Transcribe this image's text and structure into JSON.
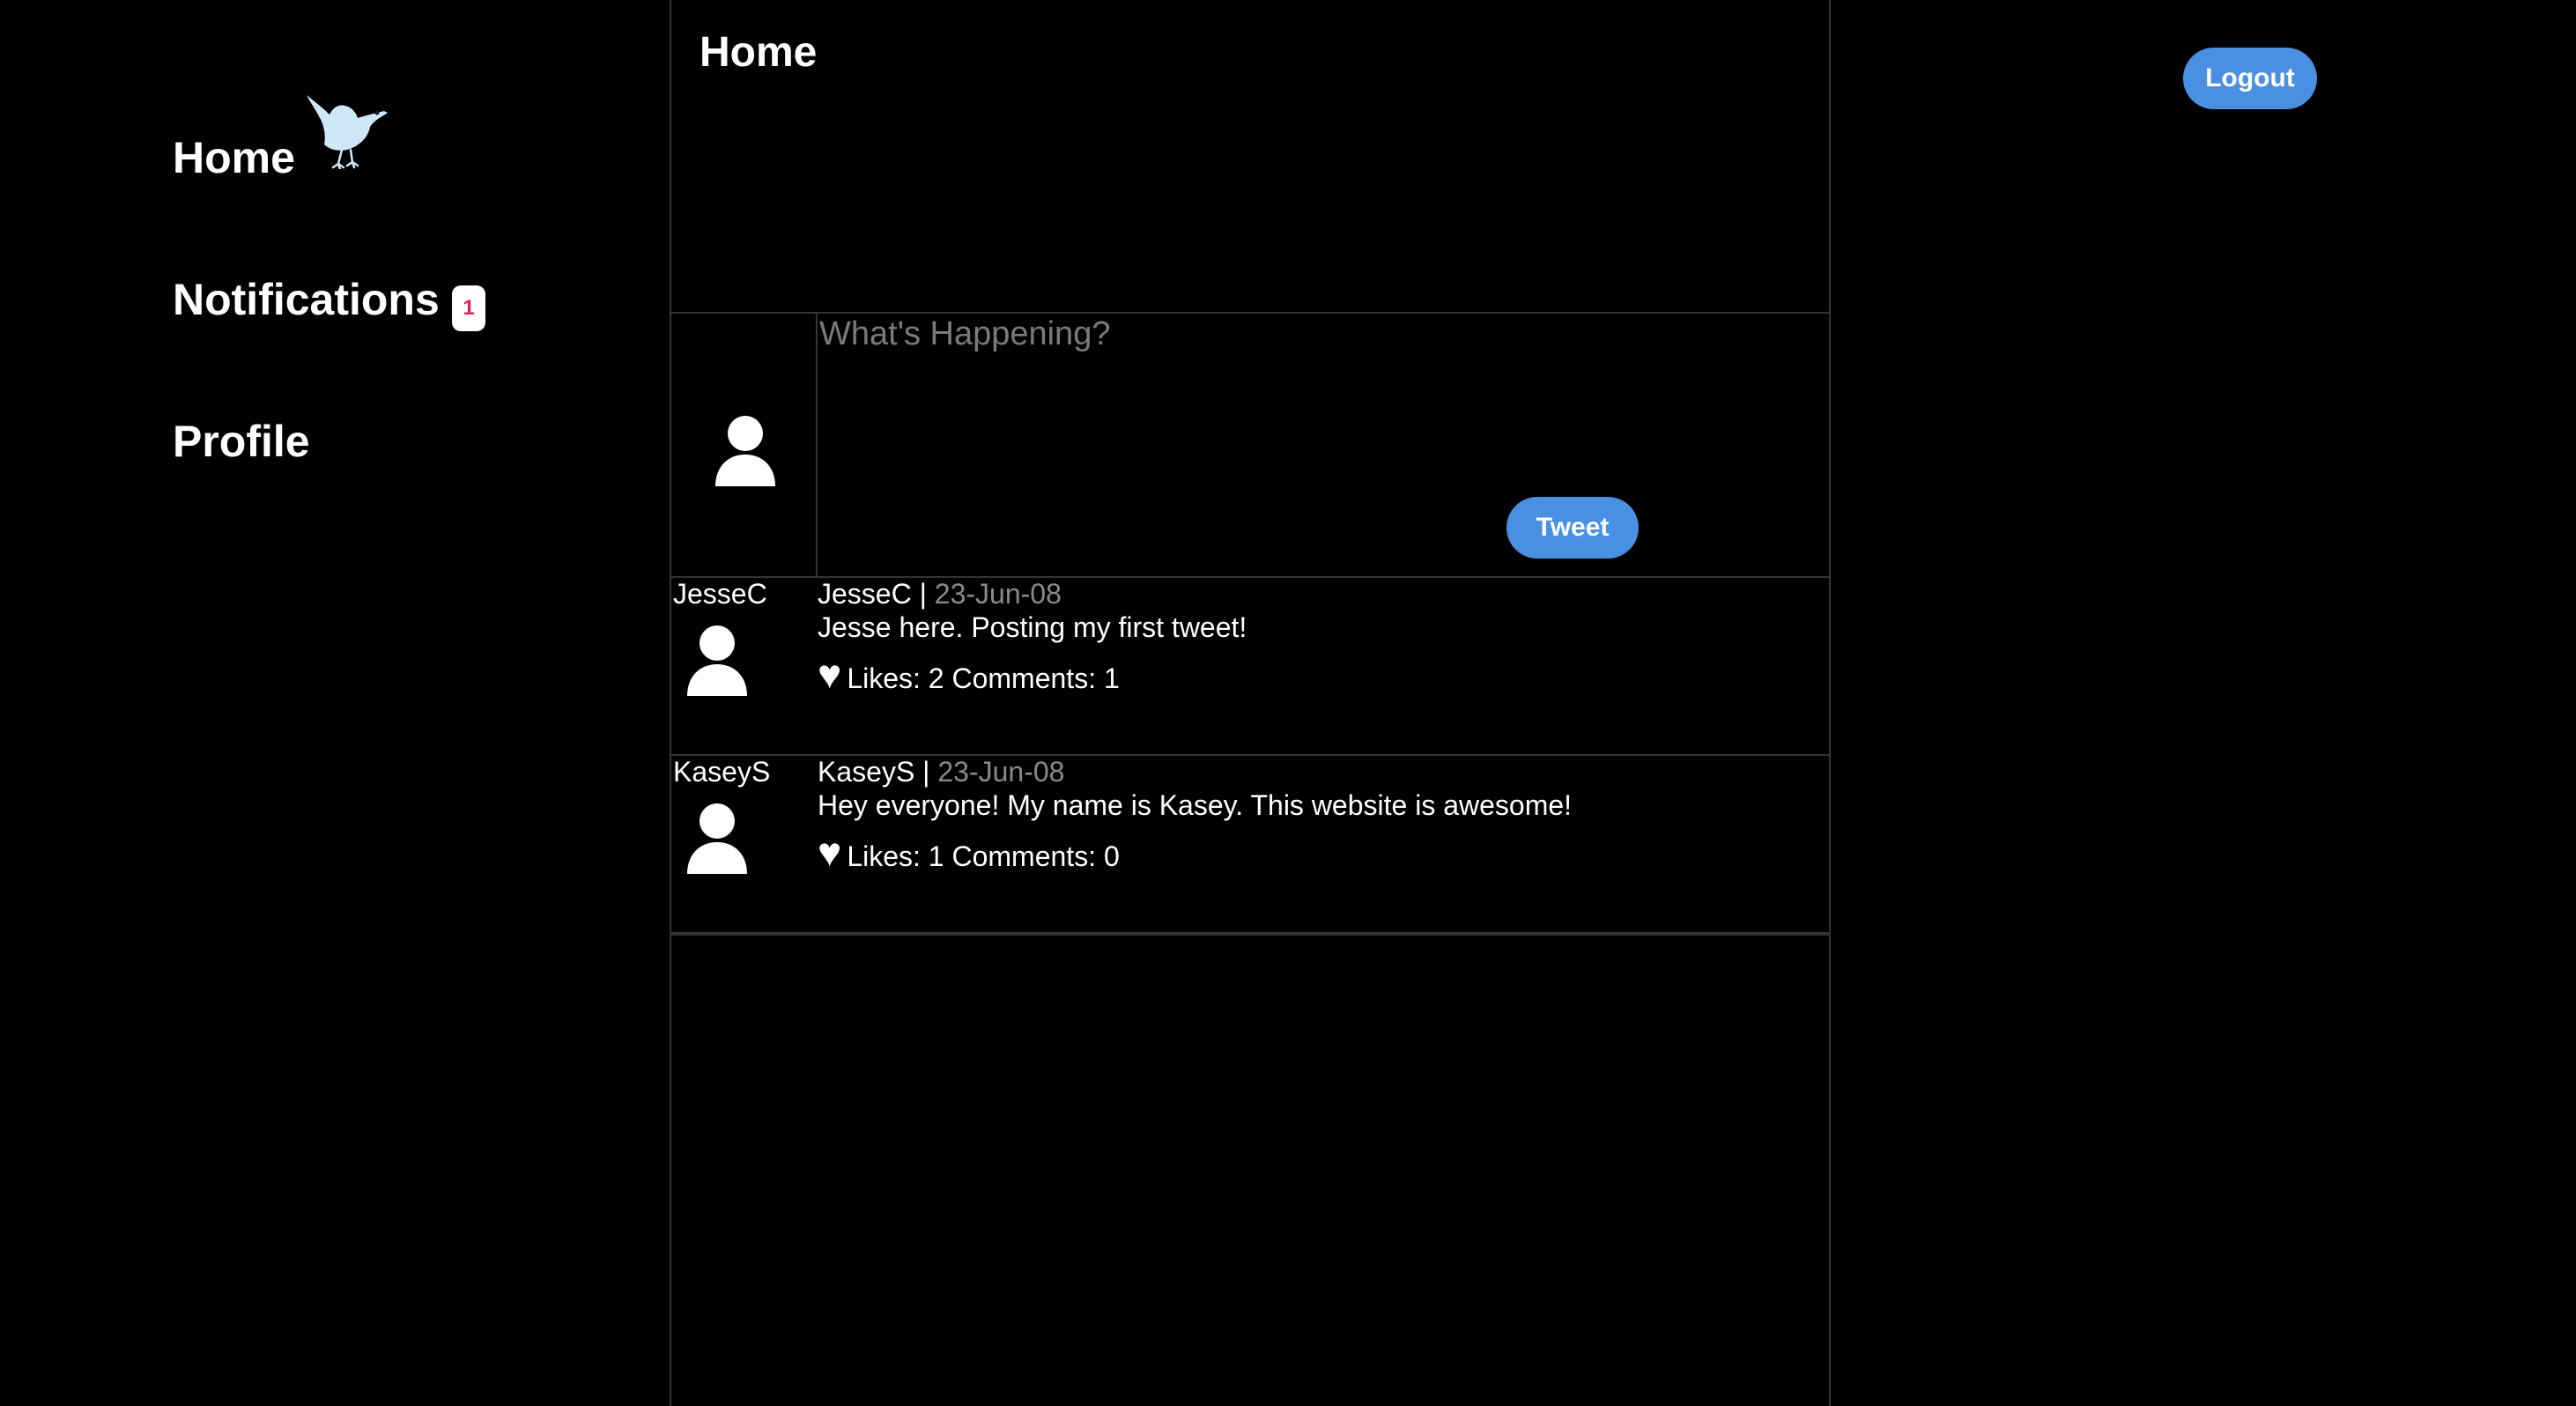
{
  "sidebar": {
    "items": [
      {
        "label": "Home"
      },
      {
        "label": "Notifications",
        "badge": "1"
      },
      {
        "label": "Profile"
      }
    ],
    "logo_icon": "bird-icon"
  },
  "main": {
    "title": "Home",
    "compose": {
      "placeholder": "What's Happening?",
      "value": "",
      "button_label": "Tweet",
      "avatar_icon": "user-avatar-icon"
    },
    "tweets": [
      {
        "author": "JesseC",
        "separator": " | ",
        "date": "23-Jun-08",
        "text": "Jesse here. Posting my first tweet!",
        "stats": "Likes: 2 Comments: 1",
        "like_icon": "heart-icon"
      },
      {
        "author": "KaseyS",
        "separator": " | ",
        "date": "23-Jun-08",
        "text": "Hey everyone! My name is Kasey. This website is awesome!",
        "stats": "Likes: 1 Comments: 0",
        "like_icon": "heart-icon"
      }
    ]
  },
  "header": {
    "logout_label": "Logout"
  },
  "colors": {
    "background": "#000000",
    "accent": "#4a90e2",
    "badge_text": "#e0245e",
    "muted_text": "#8a8a8a",
    "divider": "#333333",
    "logo": "#cfe8f7"
  }
}
